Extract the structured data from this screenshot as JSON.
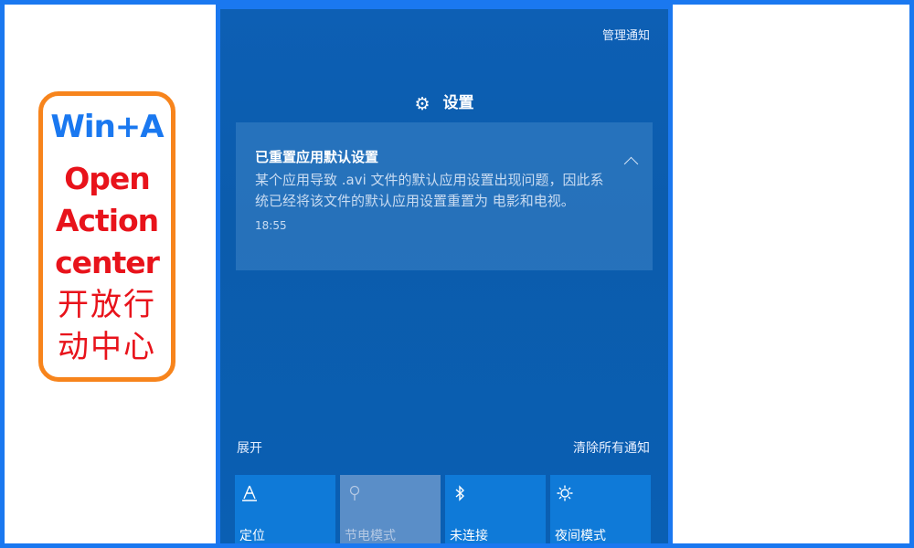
{
  "callout": {
    "hotkey": "Win+A",
    "line1": "Open",
    "line2": "Action",
    "line3": "center",
    "zh_line1": "开放行",
    "zh_line2": "动中心"
  },
  "panel": {
    "manage_label": "管理通知",
    "app_name": "设置",
    "app_icon": "gear-icon",
    "notification": {
      "title": "已重置应用默认设置",
      "body": "某个应用导致 .avi 文件的默认应用设置出现问题，因此系统已经将该文件的默认应用设置重置为 电影和电视。",
      "time": "18:55"
    },
    "expand_label": "展开",
    "clear_label": "清除所有通知"
  },
  "quick_actions": [
    {
      "label": "定位",
      "icon": "location-icon",
      "state": "on"
    },
    {
      "label": "节电模式",
      "icon": "battery-saver-icon",
      "state": "off"
    },
    {
      "label": "未连接",
      "icon": "bluetooth-icon",
      "state": "on"
    },
    {
      "label": "夜间模式",
      "icon": "night-light-icon",
      "state": "on"
    }
  ],
  "colors": {
    "frame_blue": "#1a78f0",
    "callout_orange": "#f7841c",
    "callout_red": "#e8131b",
    "panel_bg": "#0b5cac",
    "tile_on": "#0f7ad8",
    "tile_off": "#5a8ec8"
  }
}
